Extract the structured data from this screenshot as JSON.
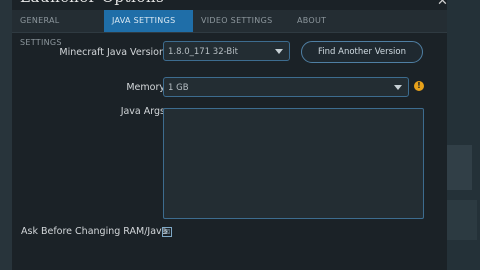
{
  "window": {
    "title": "Launcher Options"
  },
  "tabs": [
    {
      "label": "GENERAL SETTINGS"
    },
    {
      "label": "JAVA SETTINGS"
    },
    {
      "label": "VIDEO SETTINGS"
    },
    {
      "label": "ABOUT"
    }
  ],
  "active_tab": 1,
  "java_version": {
    "label": "Minecraft Java Version",
    "value": "1.8.0_171 32-Bit",
    "find_button": "Find Another Version"
  },
  "memory": {
    "label": "Memory",
    "value": "1 GB",
    "warning_icon": "warning-icon"
  },
  "java_args": {
    "label": "Java Args",
    "value": ""
  },
  "ask_before": {
    "label": "Ask Before Changing RAM/Java",
    "checked": true,
    "mark": "☒"
  },
  "colors": {
    "accent": "#1f6ea8",
    "warning": "#e8a21a",
    "background": "#1b2227"
  }
}
